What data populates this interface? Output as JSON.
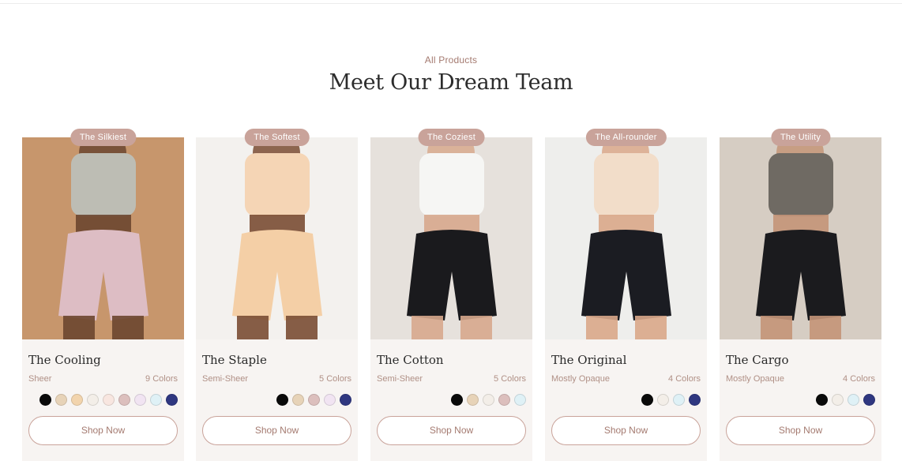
{
  "section": {
    "eyebrow": "All Products",
    "title": "Meet Our Dream Team"
  },
  "products": [
    {
      "badge": "The Silkiest",
      "name": "The Cooling",
      "opacity": "Sheer",
      "colors_label": "9 Colors",
      "swatches": [
        "#0a0a0a",
        "#e7d3b8",
        "#f2d4ad",
        "#f3eee8",
        "#f8e6e0",
        "#dcbfbd",
        "#f1e4f2",
        "#dff1f6",
        "#2f3780"
      ],
      "cta": "Shop Now",
      "photo": {
        "bg": "#c7966c",
        "garment": "#ddbdc4",
        "top": "#bdbdb4",
        "skin": "#6b4630"
      }
    },
    {
      "badge": "The Softest",
      "name": "The Staple",
      "opacity": "Semi-Sheer",
      "colors_label": "5 Colors",
      "swatches": [
        "#0a0a0a",
        "#e7d3b8",
        "#dcbfbd",
        "#f1e4f2",
        "#2f3780"
      ],
      "cta": "Shop Now",
      "photo": {
        "bg": "#f3f1ee",
        "garment": "#f4cfa6",
        "top": "#f5d5b5",
        "skin": "#7a4c33"
      }
    },
    {
      "badge": "The Coziest",
      "name": "The Cotton",
      "opacity": "Semi-Sheer",
      "colors_label": "5 Colors",
      "swatches": [
        "#0a0a0a",
        "#e7d3b8",
        "#f3eee8",
        "#dcbfbd",
        "#dff1f6"
      ],
      "cta": "Shop Now",
      "photo": {
        "bg": "#e6e1dc",
        "garment": "#1a1a1d",
        "top": "#f6f6f4",
        "skin": "#d7a98d"
      }
    },
    {
      "badge": "The All-rounder",
      "name": "The Original",
      "opacity": "Mostly Opaque",
      "colors_label": "4 Colors",
      "swatches": [
        "#0a0a0a",
        "#f3eee8",
        "#dff1f6",
        "#2f3780"
      ],
      "cta": "Shop Now",
      "photo": {
        "bg": "#eeeeec",
        "garment": "#1b1c22",
        "top": "#f2ddc9",
        "skin": "#d9a78a"
      }
    },
    {
      "badge": "The Utility",
      "name": "The Cargo",
      "opacity": "Mostly Opaque",
      "colors_label": "4 Colors",
      "swatches": [
        "#0a0a0a",
        "#f3eee8",
        "#dff1f6",
        "#2f3780"
      ],
      "cta": "Shop Now",
      "photo": {
        "bg": "#d6cdc3",
        "garment": "#1b1b1e",
        "top": "#6f6a63",
        "skin": "#c49578"
      }
    }
  ],
  "colors": {
    "accent": "#a47a70",
    "badge_bg": "#c9a39a",
    "card_bg": "#f7f4f2",
    "heading": "#2c2c2c"
  }
}
